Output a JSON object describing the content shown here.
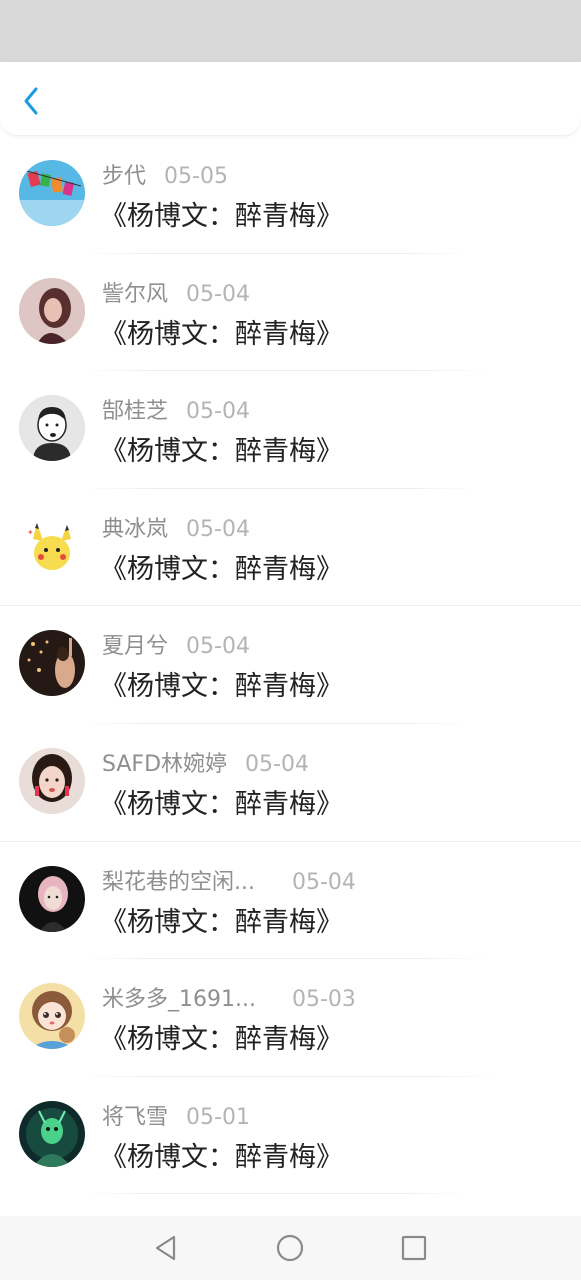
{
  "header": {
    "back_icon": "chevron-left-icon",
    "accent_color": "#1a9be0"
  },
  "items": [
    {
      "name": "步代",
      "date": "05-05",
      "title": "《杨博文：醉青梅》",
      "avatar": "colorful-photo"
    },
    {
      "name": "訾尔风",
      "date": "05-04",
      "title": "《杨博文：醉青梅》",
      "avatar": "girl-portrait"
    },
    {
      "name": "郜桂芝",
      "date": "05-04",
      "title": "《杨博文：醉青梅》",
      "avatar": "cartoon-boy"
    },
    {
      "name": "典冰岚",
      "date": "05-04",
      "title": "《杨博文：醉青梅》",
      "avatar": "pikachu"
    },
    {
      "name": "夏月兮",
      "date": "05-04",
      "title": "《杨博文：醉青梅》",
      "avatar": "night-photo"
    },
    {
      "name": "SAFD林婉婷",
      "date": "05-04",
      "title": "《杨博文：醉青梅》",
      "avatar": "selfie"
    },
    {
      "name": "梨花巷的空闲...",
      "date": "05-04",
      "title": "《杨博文：醉青梅》",
      "avatar": "dark-portrait"
    },
    {
      "name": "米多多_1691...",
      "date": "05-03",
      "title": "《杨博文：醉青梅》",
      "avatar": "anime-girl"
    },
    {
      "name": "将飞雪",
      "date": "05-01",
      "title": "《杨博文：醉青梅》",
      "avatar": "game-character"
    }
  ],
  "nav": {
    "back": "triangle-back-icon",
    "home": "circle-home-icon",
    "recent": "square-recent-icon"
  }
}
